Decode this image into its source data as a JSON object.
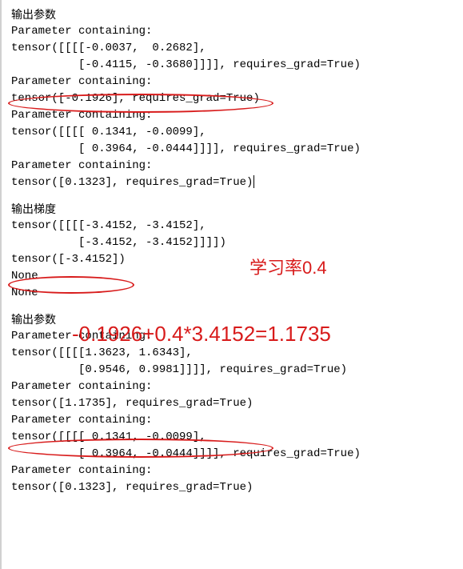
{
  "section1": {
    "heading": "输出参数",
    "lines": [
      "Parameter containing:",
      "tensor([[[[-0.0037,  0.2682],",
      "          [-0.4115, -0.3680]]]], requires_grad=True)",
      "Parameter containing:",
      "tensor([-0.1926], requires_grad=True)",
      "Parameter containing:",
      "tensor([[[[ 0.1341, -0.0099],",
      "          [ 0.3964, -0.0444]]]], requires_grad=True)",
      "Parameter containing:",
      "tensor([0.1323], requires_grad=True)"
    ]
  },
  "section2": {
    "heading": "输出梯度",
    "lines": [
      "tensor([[[[-3.4152, -3.4152],",
      "          [-3.4152, -3.4152]]]])",
      "tensor([-3.4152])",
      "None",
      "None"
    ]
  },
  "section3": {
    "heading": "输出参数",
    "lines": [
      "Parameter containing:",
      "tensor([[[[1.3623, 1.6343],",
      "          [0.9546, 0.9981]]]], requires_grad=True)",
      "Parameter containing:",
      "tensor([1.1735], requires_grad=True)",
      "Parameter containing:",
      "tensor([[[[ 0.1341, -0.0099],",
      "          [ 0.3964, -0.0444]]]], requires_grad=True)",
      "Parameter containing:",
      "tensor([0.1323], requires_grad=True)"
    ]
  },
  "annotations": {
    "learning_rate": "学习率0.4",
    "equation": "-0.1926+0.4*3.4152=1.1735"
  }
}
